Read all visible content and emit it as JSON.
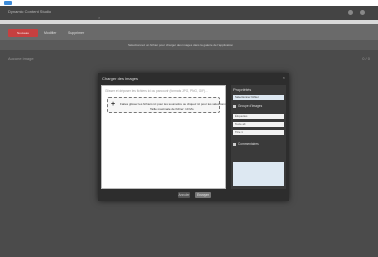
{
  "window": {
    "title": "Dynamic Content Studio"
  },
  "toolbar": {
    "primary_label": "Nouveau",
    "items": [
      "Modifier",
      "Supprimer"
    ]
  },
  "subbar": {
    "message": "Sélectionnez un fichier pour charger des images dans la galerie de l'application"
  },
  "content": {
    "row_text": "Aucune image",
    "right_text": "0 / 0"
  },
  "modal": {
    "title": "Charger des images",
    "close": "×",
    "hint": "Glisser et déposer les fichiers ici ou parcourir (formats JPG, PNG, GIF)...",
    "dropzone_line1": "Faites glisser les fichiers ici pour les soumettre ou cliquez ici pour les sélectionner",
    "dropzone_line2": "Taille maximale de fichier: 10 Mo",
    "panel": {
      "title": "Propriétés",
      "file_value": "Sélectionner fichier",
      "group_label": "Groupe d'images",
      "tag_placeholder": "Étiquettes",
      "alt_placeholder": "Texte alt",
      "option_label": "Titre 1",
      "comments_label": "Commentaires"
    },
    "buttons": {
      "cancel": "Annuler",
      "submit": "Envoyer"
    }
  }
}
